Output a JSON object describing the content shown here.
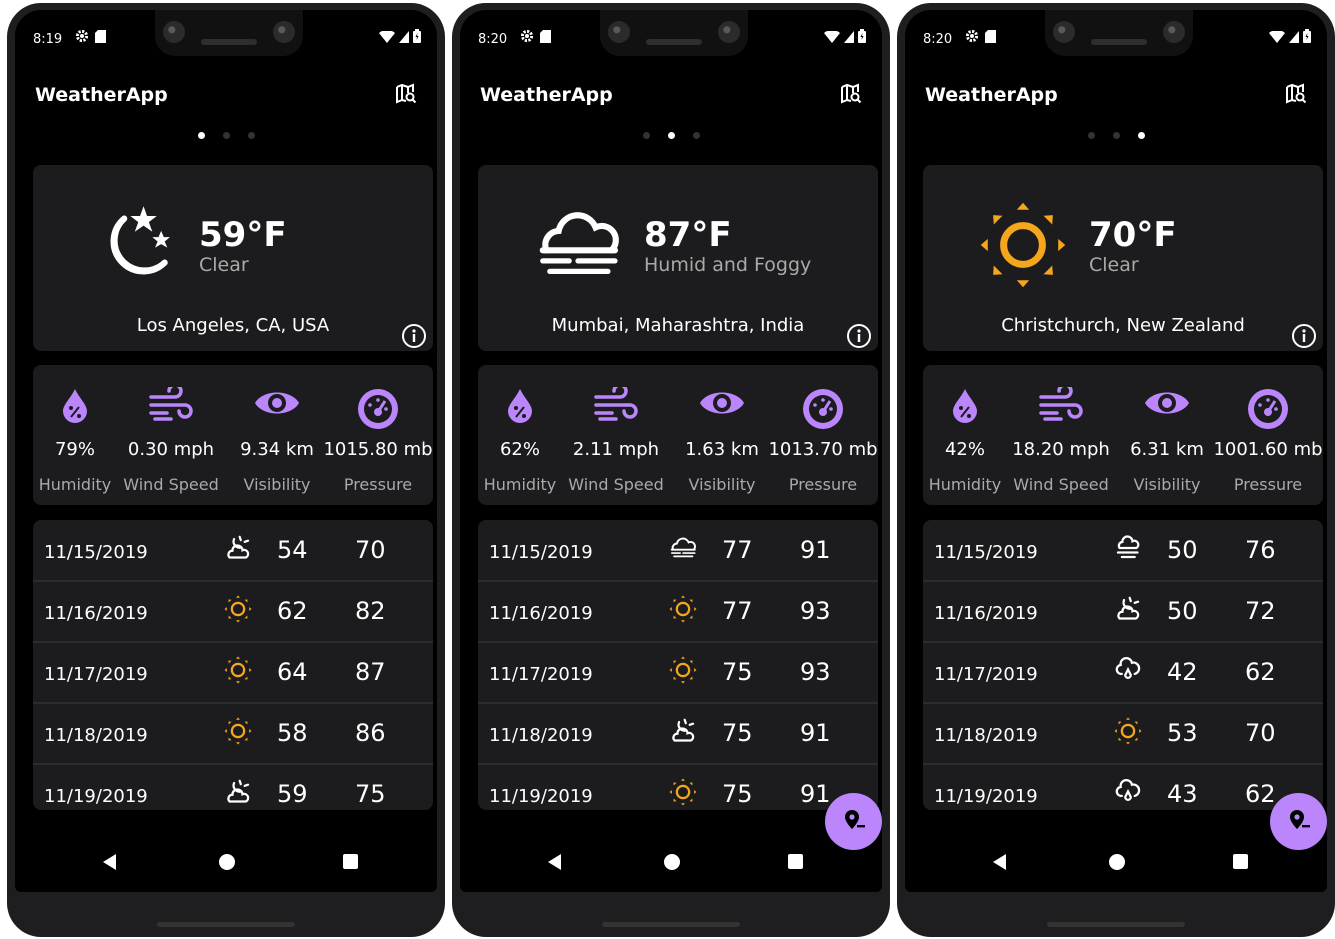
{
  "screens": [
    {
      "time": "8:19",
      "app_title": "WeatherApp",
      "active_page": 0,
      "current": {
        "temperature": "59°F",
        "condition": "Clear",
        "location": "Los Angeles, CA, USA",
        "icon": "moon-stars"
      },
      "metrics": [
        {
          "value": "79%",
          "label": "Humidity",
          "icon": "humidity-icon"
        },
        {
          "value": "0.30 mph",
          "label": "Wind Speed",
          "icon": "wind-icon"
        },
        {
          "value": "9.34 km",
          "label": "Visibility",
          "icon": "visibility-icon"
        },
        {
          "value": "1015.80 mb",
          "label": "Pressure",
          "icon": "pressure-icon"
        }
      ],
      "forecast": [
        {
          "date": "11/15/2019",
          "icon": "night-cloud",
          "low": "54",
          "high": "70"
        },
        {
          "date": "11/16/2019",
          "icon": "sun",
          "low": "62",
          "high": "82"
        },
        {
          "date": "11/17/2019",
          "icon": "sun",
          "low": "64",
          "high": "87"
        },
        {
          "date": "11/18/2019",
          "icon": "sun",
          "low": "58",
          "high": "86"
        },
        {
          "date": "11/19/2019",
          "icon": "night-cloud",
          "low": "59",
          "high": "75"
        }
      ],
      "show_fab": false
    },
    {
      "time": "8:20",
      "app_title": "WeatherApp",
      "active_page": 1,
      "current": {
        "temperature": "87°F",
        "condition": "Humid and Foggy",
        "location": "Mumbai, Maharashtra, India",
        "icon": "fog"
      },
      "metrics": [
        {
          "value": "62%",
          "label": "Humidity",
          "icon": "humidity-icon"
        },
        {
          "value": "2.11 mph",
          "label": "Wind Speed",
          "icon": "wind-icon"
        },
        {
          "value": "1.63 km",
          "label": "Visibility",
          "icon": "visibility-icon"
        },
        {
          "value": "1013.70 mb",
          "label": "Pressure",
          "icon": "pressure-icon"
        }
      ],
      "forecast": [
        {
          "date": "11/15/2019",
          "icon": "fog",
          "low": "77",
          "high": "91"
        },
        {
          "date": "11/16/2019",
          "icon": "sun",
          "low": "77",
          "high": "93"
        },
        {
          "date": "11/17/2019",
          "icon": "sun",
          "low": "75",
          "high": "93"
        },
        {
          "date": "11/18/2019",
          "icon": "night-cloud",
          "low": "75",
          "high": "91"
        },
        {
          "date": "11/19/2019",
          "icon": "sun",
          "low": "75",
          "high": "91"
        }
      ],
      "show_fab": true
    },
    {
      "time": "8:20",
      "app_title": "WeatherApp",
      "active_page": 2,
      "current": {
        "temperature": "70°F",
        "condition": "Clear",
        "location": "Christchurch, New Zealand",
        "icon": "sun"
      },
      "metrics": [
        {
          "value": "42%",
          "label": "Humidity",
          "icon": "humidity-icon"
        },
        {
          "value": "18.20 mph",
          "label": "Wind Speed",
          "icon": "wind-icon"
        },
        {
          "value": "6.31 km",
          "label": "Visibility",
          "icon": "visibility-icon"
        },
        {
          "value": "1001.60 mb",
          "label": "Pressure",
          "icon": "pressure-icon"
        }
      ],
      "forecast": [
        {
          "date": "11/15/2019",
          "icon": "cloud-wind",
          "low": "50",
          "high": "76"
        },
        {
          "date": "11/16/2019",
          "icon": "night-cloud",
          "low": "50",
          "high": "72"
        },
        {
          "date": "11/17/2019",
          "icon": "cloud-rain",
          "low": "42",
          "high": "62"
        },
        {
          "date": "11/18/2019",
          "icon": "sun",
          "low": "53",
          "high": "70"
        },
        {
          "date": "11/19/2019",
          "icon": "cloud-rain",
          "low": "43",
          "high": "62"
        }
      ],
      "show_fab": true
    }
  ],
  "colors": {
    "accent": "#bb86fc",
    "sun": "#f4a71d",
    "card": "#1c1c1e",
    "muted": "#a9a9a9"
  }
}
